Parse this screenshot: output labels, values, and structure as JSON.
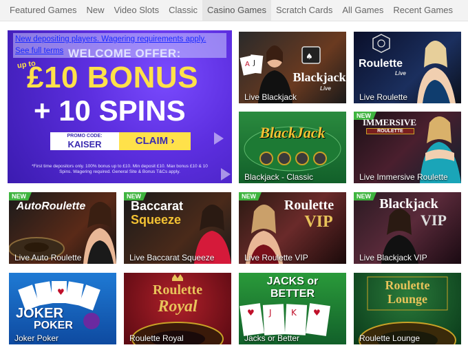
{
  "nav": {
    "items": [
      {
        "label": "Featured Games",
        "active": false
      },
      {
        "label": "New",
        "active": false
      },
      {
        "label": "Video Slots",
        "active": false
      },
      {
        "label": "Classic",
        "active": false
      },
      {
        "label": "Casino Games",
        "active": true
      },
      {
        "label": "Scratch Cards",
        "active": false
      },
      {
        "label": "All Games",
        "active": false
      },
      {
        "label": "Recent Games",
        "active": false
      }
    ]
  },
  "banner": {
    "notice_line1": "New depositing players. Wagering requirements apply.",
    "notice_line2": "See full terms",
    "offer_heading": "WELCOME OFFER:",
    "up_to": "up to",
    "bonus_text": "£10 BONUS",
    "spins_text": "+ 10 SPINS",
    "promo_label": "PROMO CODE:",
    "promo_code": "KAISER",
    "claim_label": "CLAIM ›",
    "fine_print": "*First time depositors only. 100% bonus up to £10. Min deposit £10. Max bonus £10 & 10 Spins. Wagering required. General Site & Bonus T&Cs apply."
  },
  "badge_label": "NEW",
  "games": [
    {
      "caption": "Live Blackjack",
      "logo": "Blackjack",
      "logo_sub": "Live",
      "new": false
    },
    {
      "caption": "Live Roulette",
      "logo": "Roulette",
      "logo_sub": "Live",
      "new": false
    },
    {
      "caption": "Blackjack - Classic",
      "logo": "BlackJack",
      "logo_sub": "",
      "new": false
    },
    {
      "caption": "Live Immersive Roulette",
      "logo": "IMMERSIVE",
      "logo_sub": "ROULETTE",
      "new": true
    },
    {
      "caption": "Live Auto Roulette",
      "logo": "AutoRoulette",
      "logo_sub": "",
      "new": true
    },
    {
      "caption": "Live Baccarat Squeeze",
      "logo": "Baccarat",
      "logo_sub": "Squeeze",
      "new": true
    },
    {
      "caption": "Live Roulette VIP",
      "logo": "Roulette",
      "logo_sub": "VIP",
      "new": true
    },
    {
      "caption": "Live Blackjack VIP",
      "logo": "Blackjack",
      "logo_sub": "VIP",
      "new": true
    },
    {
      "caption": "Joker Poker",
      "logo": "JOKER",
      "logo_sub": "POKER",
      "new": false
    },
    {
      "caption": "Roulette Royal",
      "logo": "Roulette",
      "logo_sub": "Royal",
      "new": false
    },
    {
      "caption": "Jacks or Better",
      "logo": "JACKS or",
      "logo_sub": "BETTER",
      "new": false
    },
    {
      "caption": "Roulette Lounge",
      "logo": "Roulette",
      "logo_sub": "Lounge",
      "new": false
    }
  ]
}
